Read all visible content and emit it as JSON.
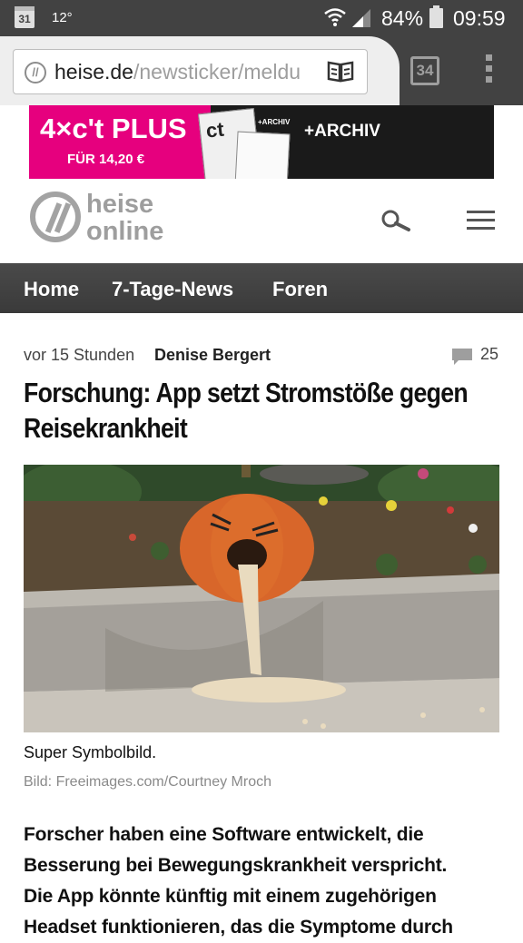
{
  "status_bar": {
    "calendar_date": "31",
    "temperature": "12°",
    "battery_percent": "84%",
    "time": "09:59",
    "icons": [
      "calendar-icon",
      "wifi-icon",
      "signal-icon",
      "battery-icon"
    ]
  },
  "browser": {
    "url_domain": "heise.de",
    "url_path": "/newsticker/meldu",
    "tab_count": "34",
    "icons": [
      "site-info-icon",
      "reader-mode-icon",
      "tabs-icon",
      "overflow-menu-icon"
    ]
  },
  "ad": {
    "headline": "4×c't PLUS",
    "price": "FÜR 14,20 €",
    "mag_logo": "ct",
    "archiv_small": "+ARCHIV",
    "archiv": "+ARCHIV"
  },
  "site": {
    "logo_line1": "heise",
    "logo_line2": "online",
    "icons": [
      "search-icon",
      "hamburger-menu-icon"
    ]
  },
  "nav": {
    "items": [
      {
        "label": "Home"
      },
      {
        "label": "7-Tage-News"
      },
      {
        "label": "Foren"
      }
    ]
  },
  "article": {
    "time": "vor 15 Stunden",
    "author": "Denise Bergert",
    "comment_count": "25",
    "headline_line1": "Forschung: App setzt Stromstöße gegen",
    "headline_line2": "Reisekrankheit",
    "caption": "Super Symbolbild.",
    "credit": "Bild: Freeimages.com/Courtney Mroch",
    "lead_lines": [
      "Forscher haben eine Software entwickelt, die",
      "Besserung bei Bewegungskrankheit verspricht.",
      "Die App könnte künftig mit einem zugehörigen",
      "Headset funktionieren, das die Symptome durch"
    ]
  },
  "colors": {
    "status_bar": "#424242",
    "ad_pink": "#e6007e",
    "nav_bg": "#3f3f3f",
    "logo_gray": "#9e9e9e"
  }
}
